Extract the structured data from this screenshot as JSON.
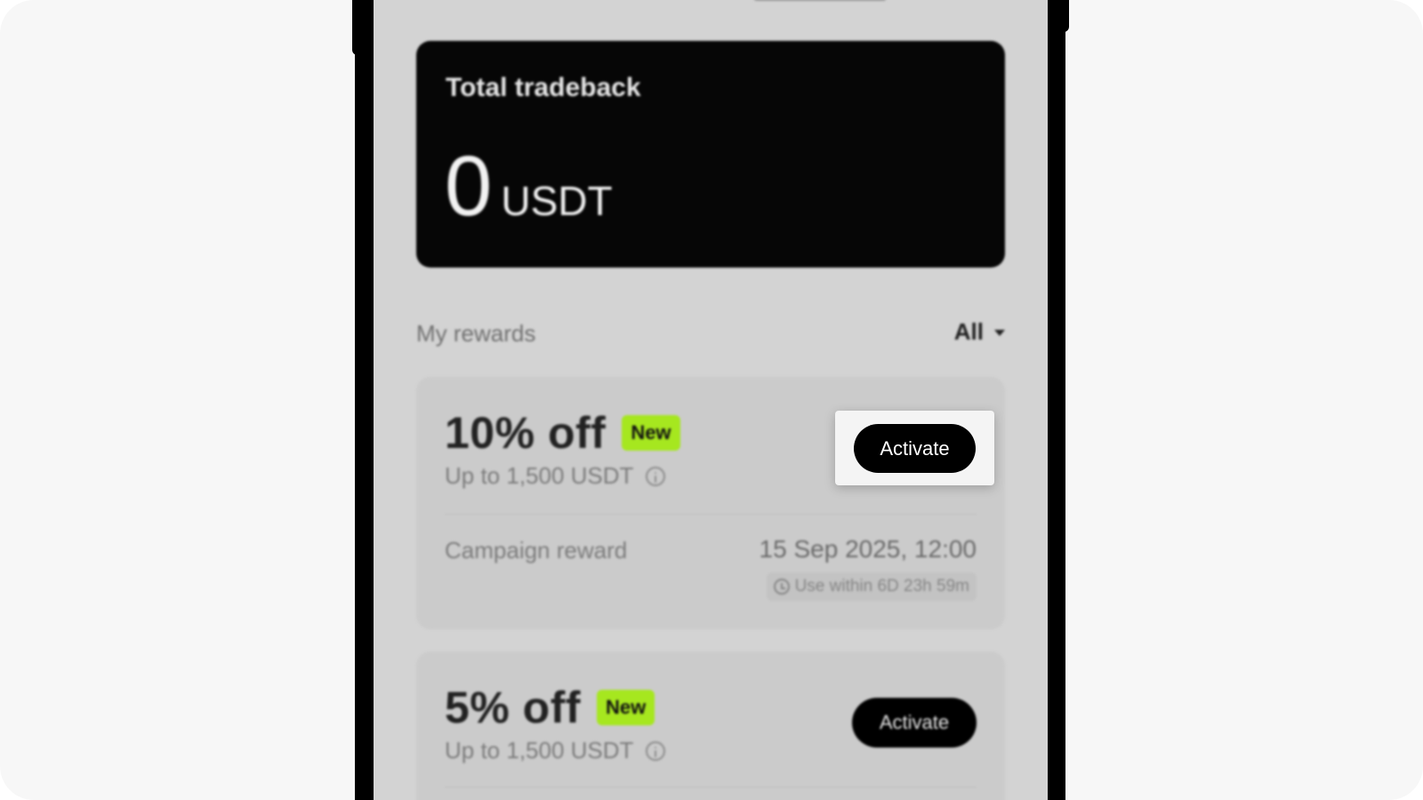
{
  "total": {
    "title": "Total tradeback",
    "value": "0",
    "unit": "USDT"
  },
  "rewards": {
    "title": "My rewards",
    "filter": "All"
  },
  "cards": [
    {
      "discount": "10% off",
      "badge": "New",
      "limit": "Up to 1,500 USDT",
      "source": "Campaign reward",
      "date": "15 Sep 2025, 12:00",
      "expiry": "Use within 6D 23h 59m",
      "button": "Activate"
    },
    {
      "discount": "5% off",
      "badge": "New",
      "limit": "Up to 1,500 USDT",
      "button": "Activate"
    }
  ],
  "colors": {
    "badge": "#a6e71f",
    "card_dark": "#060606",
    "screen_bg": "#d3d3d3"
  }
}
